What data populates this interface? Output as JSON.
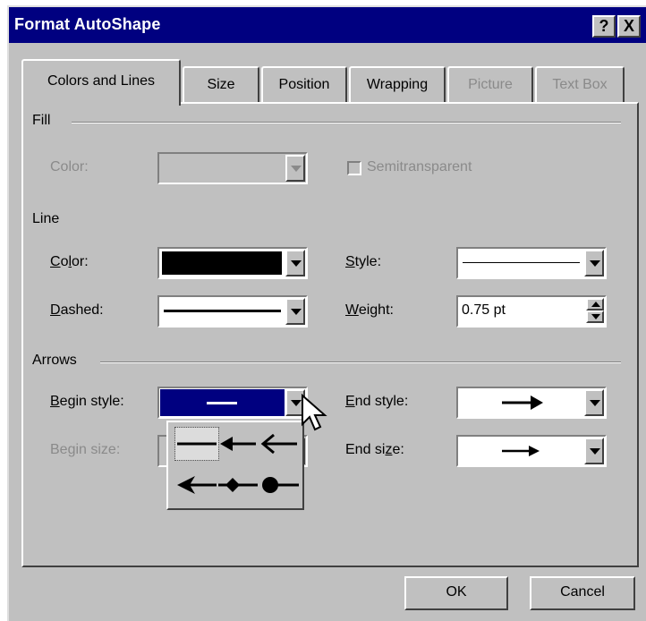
{
  "window": {
    "title": "Format AutoShape",
    "help_btn": "?",
    "close_btn": "X"
  },
  "tabs": [
    {
      "label": "Colors and Lines",
      "state": "active"
    },
    {
      "label": "Size",
      "state": "enabled"
    },
    {
      "label": "Position",
      "state": "enabled"
    },
    {
      "label": "Wrapping",
      "state": "enabled"
    },
    {
      "label": "Picture",
      "state": "disabled"
    },
    {
      "label": "Text Box",
      "state": "disabled"
    }
  ],
  "fill": {
    "group": "Fill",
    "color_label": "Color:",
    "semitransparent_label": "Semitransparent"
  },
  "line": {
    "group": "Line",
    "color_label": "Color:",
    "color_value": "#000000",
    "dashed_label": "Dashed:",
    "style_label": "Style:",
    "weight_label": "Weight:",
    "weight_value": "0.75 pt"
  },
  "arrows": {
    "group": "Arrows",
    "begin_style_label": "Begin style:",
    "begin_size_label": "Begin size:",
    "end_style_label": "End style:",
    "end_size_label": "End size:",
    "popup_options": [
      "none",
      "arrow",
      "open-arrow",
      "stealth-arrow",
      "diamond-arrow",
      "oval-arrow"
    ]
  },
  "buttons": {
    "ok": "OK",
    "cancel": "Cancel"
  },
  "colors": {
    "titlebar": "#000080",
    "face": "#c0c0c0",
    "selection": "#000080"
  }
}
